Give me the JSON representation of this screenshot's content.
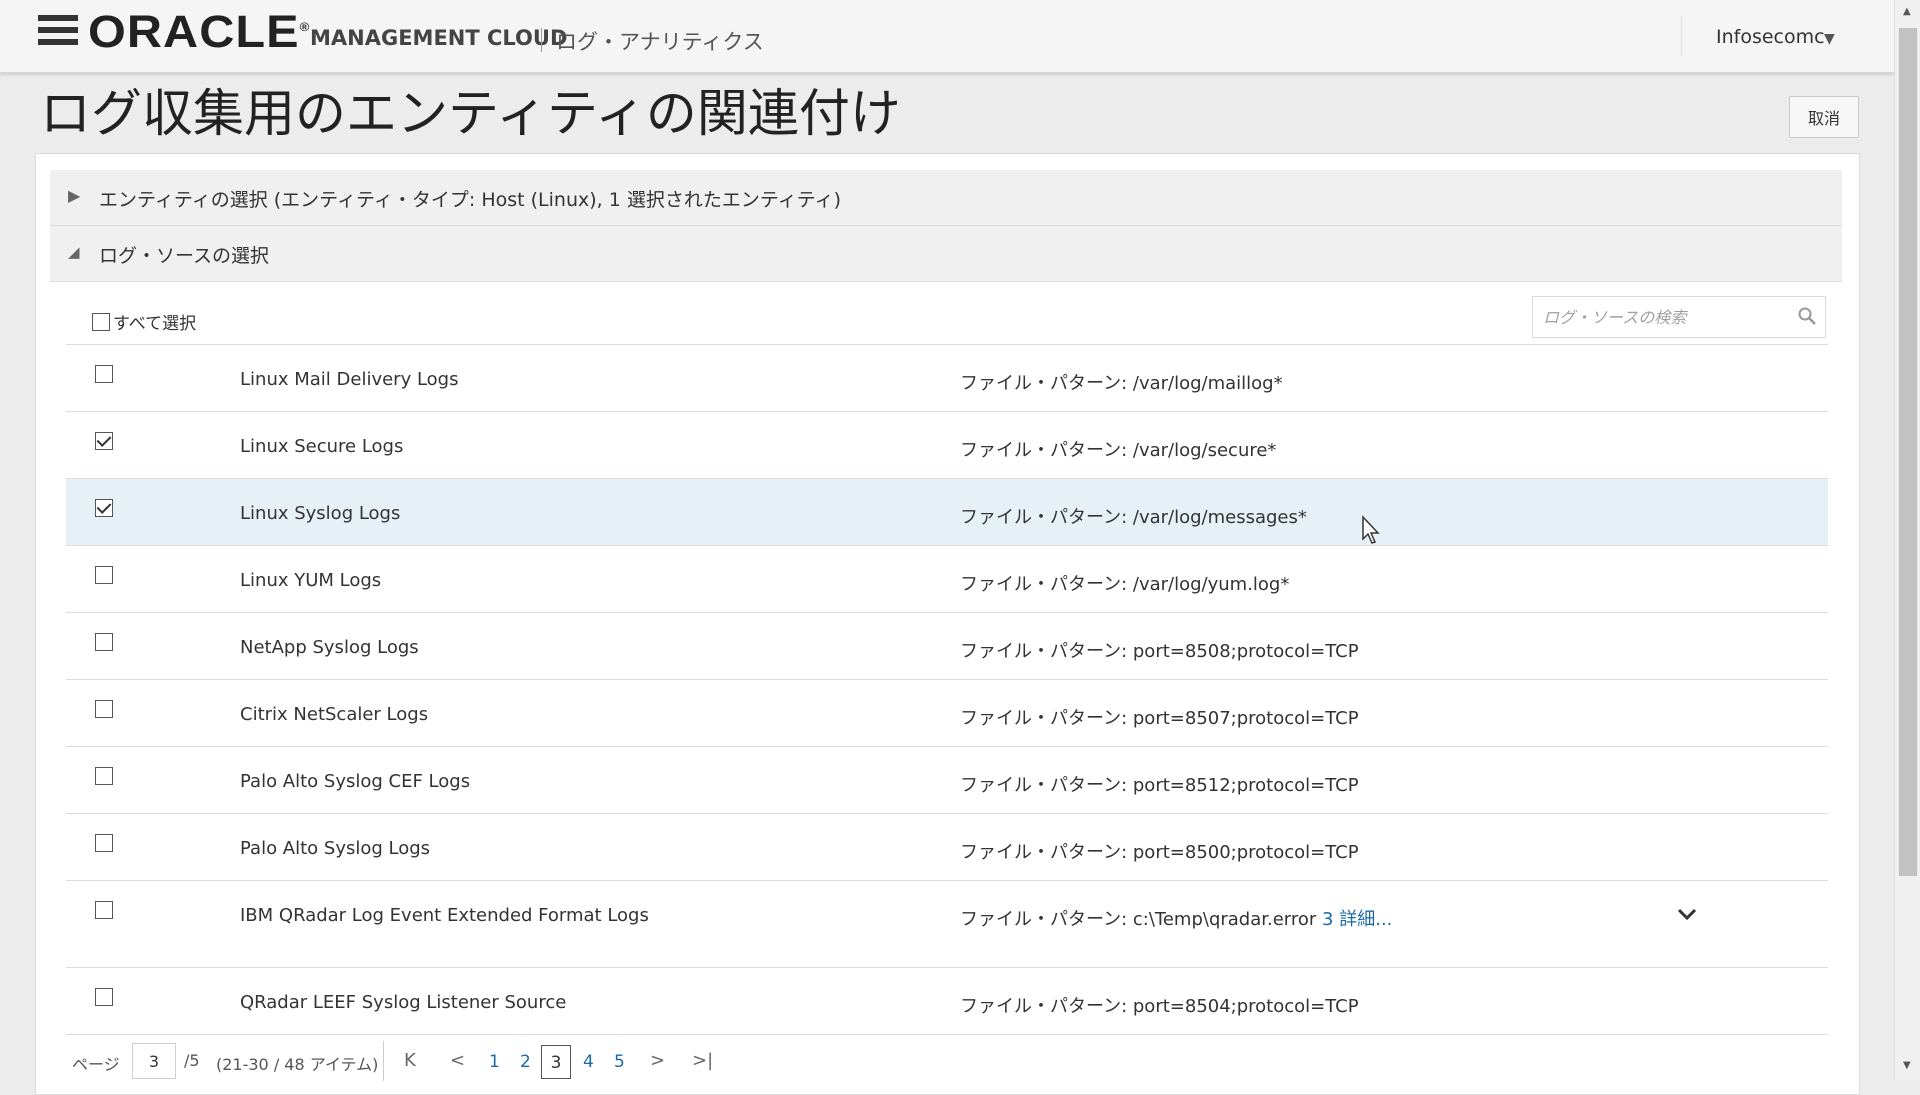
{
  "header": {
    "logo_text": "ORACLE",
    "logo_reg": "®",
    "product": "MANAGEMENT CLOUD",
    "app_name": "ログ・アナリティクス",
    "user": "Infosecomc",
    "user_caret": "▼"
  },
  "page": {
    "title": "ログ収集用のエンティティの関連付け",
    "cancel_label": "取消"
  },
  "sections": [
    {
      "label": "エンティティの選択  (エンティティ・タイプ: Host (Linux), 1 選択されたエンティティ)",
      "expanded": false,
      "icon": "▶"
    },
    {
      "label": "ログ・ソースの選択",
      "expanded": true,
      "icon": "◢"
    }
  ],
  "log_sources": {
    "select_all_label": "すべて選択",
    "search_placeholder": "ログ・ソースの検索",
    "rows": [
      {
        "name": "Linux Mail Delivery Logs",
        "pattern": "ファイル・パターン: /var/log/maillog*",
        "checked": false
      },
      {
        "name": "Linux Secure Logs",
        "pattern": "ファイル・パターン: /var/log/secure*",
        "checked": true
      },
      {
        "name": "Linux Syslog Logs",
        "pattern": "ファイル・パターン: /var/log/messages*",
        "checked": true
      },
      {
        "name": "Linux YUM Logs",
        "pattern": "ファイル・パターン: /var/log/yum.log*",
        "checked": false
      },
      {
        "name": "NetApp Syslog Logs",
        "pattern": "ファイル・パターン: port=8508;protocol=TCP",
        "checked": false
      },
      {
        "name": "Citrix NetScaler Logs",
        "pattern": "ファイル・パターン: port=8507;protocol=TCP",
        "checked": false
      },
      {
        "name": "Palo Alto Syslog CEF Logs",
        "pattern": "ファイル・パターン: port=8512;protocol=TCP",
        "checked": false
      },
      {
        "name": "Palo Alto Syslog Logs",
        "pattern": "ファイル・パターン: port=8500;protocol=TCP",
        "checked": false
      },
      {
        "name": "IBM QRadar Log Event Extended Format Logs",
        "pattern": "ファイル・パターン: c:\\Temp\\qradar.error",
        "more": "3 詳細...",
        "checked": false
      },
      {
        "name": "QRadar LEEF Syslog Listener Source",
        "pattern": "ファイル・パターン: port=8504;protocol=TCP",
        "checked": false
      }
    ]
  },
  "pagination": {
    "label": "ページ",
    "current": "3",
    "total": "/5",
    "range": "(21-30 / 48 アイテム)",
    "first": "K",
    "prev": "<",
    "next": ">",
    "last": ">|",
    "pages": [
      "1",
      "2",
      "3",
      "4",
      "5"
    ]
  },
  "colors": {
    "selected_row": "#e6f0f7",
    "link": "#1a6aa8"
  }
}
